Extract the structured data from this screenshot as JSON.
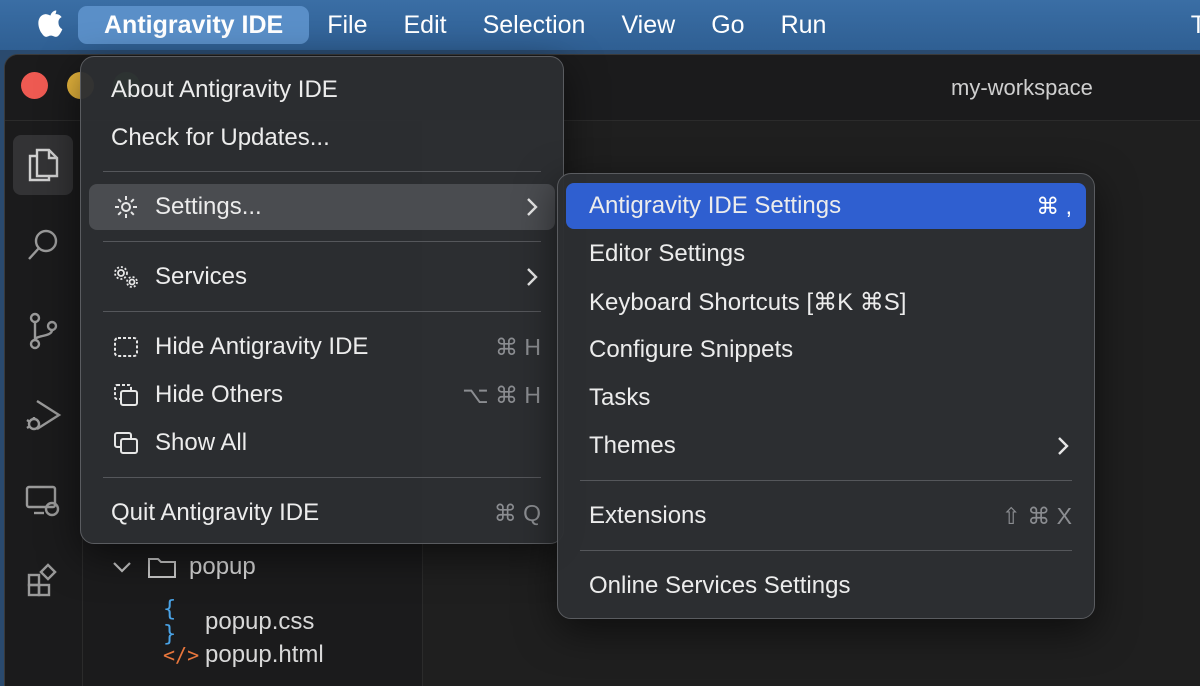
{
  "menubar": {
    "items": [
      {
        "label": "Antigravity IDE"
      },
      {
        "label": "File"
      },
      {
        "label": "Edit"
      },
      {
        "label": "Selection"
      },
      {
        "label": "View"
      },
      {
        "label": "Go"
      },
      {
        "label": "Run"
      },
      {
        "label": "T"
      }
    ]
  },
  "window": {
    "title": "my-workspace"
  },
  "explorer": {
    "rows": [
      {
        "label": "popup",
        "icon": "folder-icon"
      },
      {
        "label": "popup.css",
        "icon": "css-file-icon",
        "icon_text": "{ }"
      },
      {
        "label": "popup.html",
        "icon": "html-file-icon",
        "icon_text": "</>"
      }
    ]
  },
  "app_menu": {
    "items": [
      {
        "label": "About Antigravity IDE"
      },
      {
        "label": "Check for Updates..."
      },
      {
        "label": "Settings...",
        "icon": "gear-icon"
      },
      {
        "label": "Services",
        "icon": "services-icon"
      },
      {
        "label": "Hide Antigravity IDE",
        "icon": "hide-icon",
        "shortcut": "⌘ H"
      },
      {
        "label": "Hide Others",
        "icon": "hide-others-icon",
        "shortcut": "⌥ ⌘ H"
      },
      {
        "label": "Show All",
        "icon": "show-all-icon"
      },
      {
        "label": "Quit Antigravity IDE",
        "shortcut": "⌘ Q"
      }
    ]
  },
  "settings_submenu": {
    "items": [
      {
        "label": "Antigravity IDE Settings",
        "shortcut": "⌘ ,"
      },
      {
        "label": "Editor Settings"
      },
      {
        "label": "Keyboard Shortcuts [⌘K ⌘S]"
      },
      {
        "label": "Configure Snippets"
      },
      {
        "label": "Tasks"
      },
      {
        "label": "Themes"
      },
      {
        "label": "Extensions",
        "shortcut": "⇧ ⌘ X"
      },
      {
        "label": "Online Services Settings"
      }
    ]
  },
  "colors": {
    "menubar": "#2f5f93",
    "app_menu_highlight": "#5a8fc8",
    "selection": "#2f5fd0",
    "css_icon": "#4aa3e6",
    "html_icon": "#e8763c"
  }
}
